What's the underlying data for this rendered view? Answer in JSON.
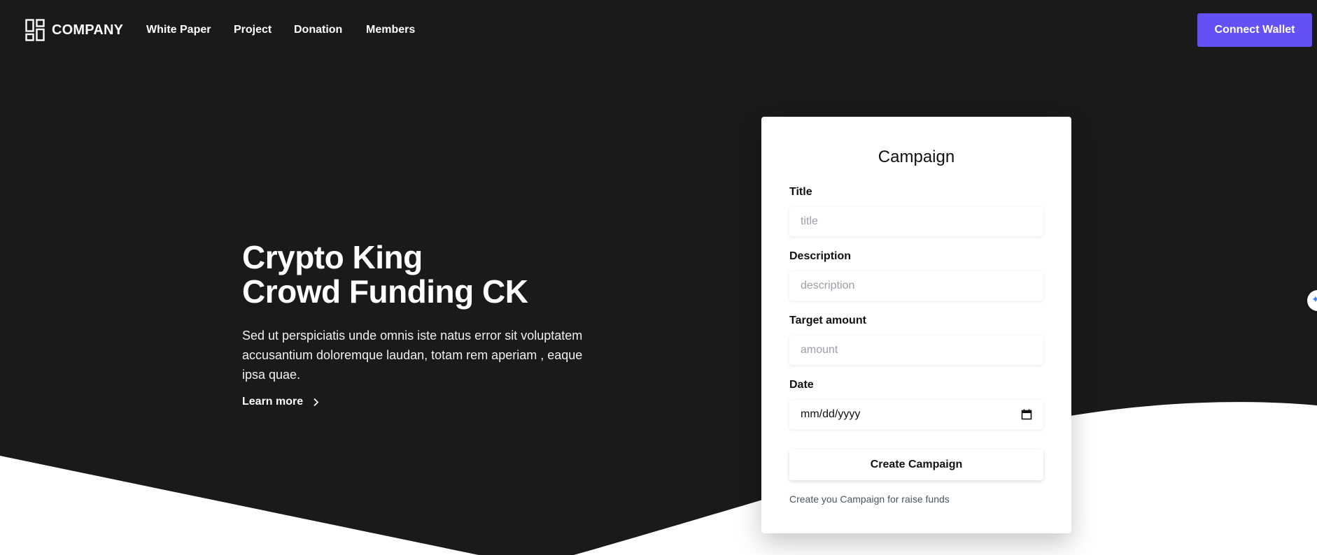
{
  "navbar": {
    "brand": "COMPANY",
    "links": [
      "White Paper",
      "Project",
      "Donation",
      "Members"
    ],
    "connect_label": "Connect Wallet"
  },
  "hero": {
    "title_line1": "Crypto King",
    "title_line2": "Crowd Funding CK",
    "description": "Sed ut perspiciatis unde omnis iste natus error sit voluptatem accusantium doloremque laudan, totam rem aperiam , eaque ipsa quae.",
    "learn_more": "Learn more"
  },
  "form": {
    "heading": "Campaign",
    "title_label": "Title",
    "title_placeholder": "title",
    "description_label": "Description",
    "description_placeholder": "description",
    "amount_label": "Target amount",
    "amount_placeholder": "amount",
    "date_label": "Date",
    "date_placeholder": "mm/dd/yyyy",
    "submit_label": "Create Campaign",
    "helper_text": "Create you Campaign for raise funds"
  },
  "colors": {
    "hero_bg": "#1a1a1a",
    "accent": "#6351f5"
  },
  "icons": [
    "company-logo-icon",
    "chevron-right-icon",
    "calendar-icon"
  ]
}
